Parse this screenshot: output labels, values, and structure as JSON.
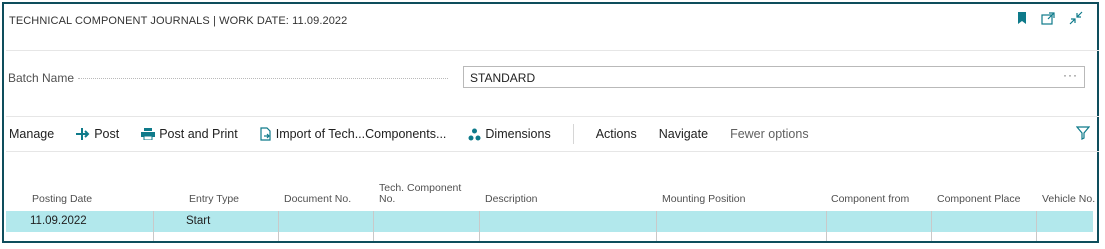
{
  "header": {
    "title": "TECHNICAL COMPONENT JOURNALS | WORK DATE: 11.09.2022",
    "icons": [
      "bookmark-icon",
      "open-new-window-icon",
      "collapse-icon"
    ]
  },
  "batch": {
    "label": "Batch Name",
    "value": "STANDARD",
    "more": "···"
  },
  "actions": {
    "manage": "Manage",
    "post": "Post",
    "post_and_print": "Post and Print",
    "import": "Import of Tech...Components...",
    "dimensions": "Dimensions",
    "actions": "Actions",
    "navigate": "Navigate",
    "fewer_options": "Fewer options"
  },
  "table": {
    "columns": [
      "Posting Date",
      "Entry Type",
      "Document No.",
      "Tech. Component No.",
      "Description",
      "Mounting Position",
      "Component from",
      "Component Place",
      "Vehicle No."
    ],
    "rows": [
      {
        "posting_date": "11.09.2022",
        "entry_type": "Start"
      }
    ]
  },
  "colors": {
    "accent": "#0e7a8a",
    "selected_row": "#b2e8ec",
    "border": "#0e4d5c"
  }
}
